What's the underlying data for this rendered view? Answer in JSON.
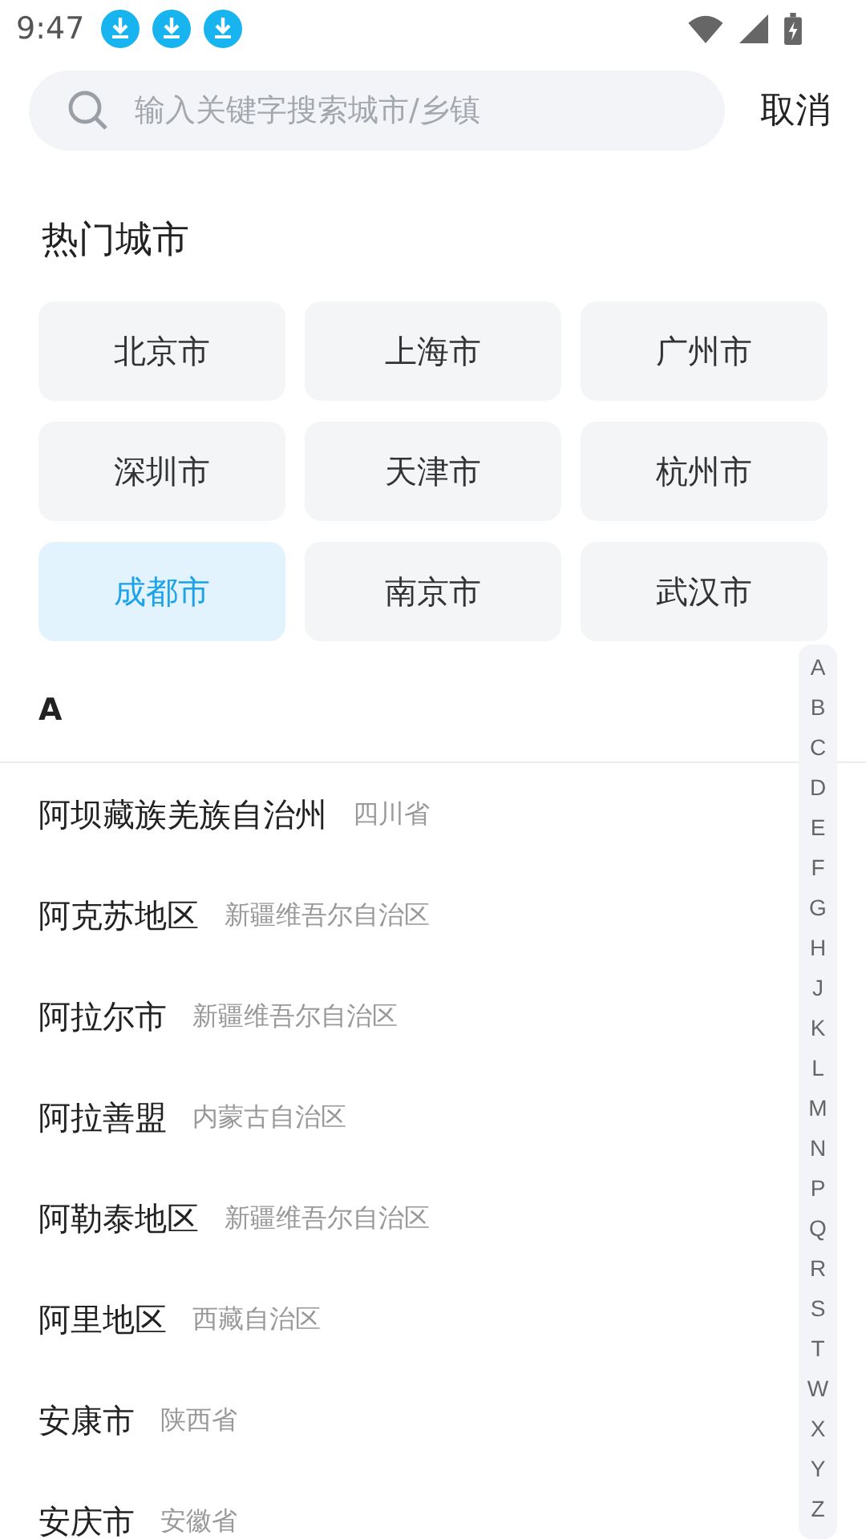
{
  "status_bar": {
    "time": "9:47",
    "notifications": [
      {
        "kind": "download"
      },
      {
        "kind": "download"
      },
      {
        "kind": "download"
      }
    ]
  },
  "search": {
    "placeholder": "输入关键字搜索城市/乡镇",
    "cancel": "取消"
  },
  "hot_cities": {
    "title": "热门城市",
    "items": [
      {
        "label": "北京市",
        "selected": false
      },
      {
        "label": "上海市",
        "selected": false
      },
      {
        "label": "广州市",
        "selected": false
      },
      {
        "label": "深圳市",
        "selected": false
      },
      {
        "label": "天津市",
        "selected": false
      },
      {
        "label": "杭州市",
        "selected": false
      },
      {
        "label": "成都市",
        "selected": true
      },
      {
        "label": "南京市",
        "selected": false
      },
      {
        "label": "武汉市",
        "selected": false
      }
    ]
  },
  "section": {
    "letter": "A",
    "cities": [
      {
        "name": "阿坝藏族羌族自治州",
        "province": "四川省"
      },
      {
        "name": "阿克苏地区",
        "province": "新疆维吾尔自治区"
      },
      {
        "name": "阿拉尔市",
        "province": "新疆维吾尔自治区"
      },
      {
        "name": "阿拉善盟",
        "province": "内蒙古自治区"
      },
      {
        "name": "阿勒泰地区",
        "province": "新疆维吾尔自治区"
      },
      {
        "name": "阿里地区",
        "province": "西藏自治区"
      },
      {
        "name": "安康市",
        "province": "陕西省"
      },
      {
        "name": "安庆市",
        "province": "安徽省"
      }
    ]
  },
  "index_bar": [
    "A",
    "B",
    "C",
    "D",
    "E",
    "F",
    "G",
    "H",
    "J",
    "K",
    "L",
    "M",
    "N",
    "P",
    "Q",
    "R",
    "S",
    "T",
    "W",
    "X",
    "Y",
    "Z"
  ]
}
